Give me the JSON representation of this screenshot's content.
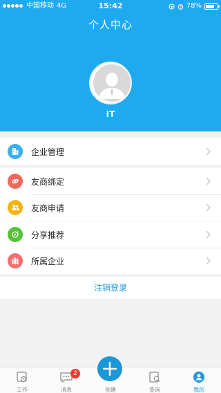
{
  "status_bar": {
    "signal_dots": 5,
    "carrier": "中国移动",
    "network": "4G",
    "time": "15:42",
    "battery": "78%",
    "battery_level": 0.78
  },
  "header": {
    "title": "个人中心",
    "username": "IT"
  },
  "menu_groups": [
    {
      "items": [
        {
          "label": "企业管理",
          "icon": "building-icon",
          "color": "#3ab0ea"
        }
      ]
    },
    {
      "items": [
        {
          "label": "友商绑定",
          "icon": "link-icon",
          "color": "#f2675c"
        },
        {
          "label": "友商申请",
          "icon": "people-icon",
          "color": "#f5b312"
        }
      ]
    },
    {
      "items": [
        {
          "label": "分享推荐",
          "icon": "share-icon",
          "color": "#57c23a"
        },
        {
          "label": "所属企业",
          "icon": "company-icon",
          "color": "#f26f6f"
        }
      ]
    }
  ],
  "logout_label": "注销登录",
  "tabs": [
    {
      "label": "工作",
      "icon": "clock-calendar-icon",
      "active": false
    },
    {
      "label": "消息",
      "icon": "chat-icon",
      "active": false,
      "badge": "2"
    },
    {
      "label": "创建",
      "icon": "plus-icon",
      "active": false
    },
    {
      "label": "查询",
      "icon": "search-doc-icon",
      "active": false
    },
    {
      "label": "我的",
      "icon": "profile-icon",
      "active": true
    }
  ],
  "colors": {
    "primary": "#1faaf0",
    "accent": "#1c97d8",
    "badge": "#f03a2e"
  }
}
